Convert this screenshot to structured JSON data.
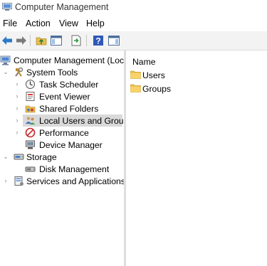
{
  "window": {
    "title": "Computer Management"
  },
  "menu": [
    "File",
    "Action",
    "View",
    "Help"
  ],
  "toolbar": {
    "buttons": [
      "back-icon",
      "forward-icon",
      "up-folder-icon",
      "show-hide-tree-icon",
      "export-list-icon",
      "help-icon",
      "show-hide-action-pane-icon"
    ]
  },
  "tree": {
    "root": {
      "label": "Computer Management (Local)",
      "icon": "computer-management-icon"
    },
    "system_tools": {
      "label": "System Tools",
      "icon": "tools-icon",
      "children": [
        {
          "label": "Task Scheduler",
          "icon": "clock-icon"
        },
        {
          "label": "Event Viewer",
          "icon": "event-viewer-icon"
        },
        {
          "label": "Shared Folders",
          "icon": "shared-folders-icon"
        },
        {
          "label": "Local Users and Groups",
          "icon": "users-icon",
          "selected": true
        },
        {
          "label": "Performance",
          "icon": "performance-icon"
        },
        {
          "label": "Device Manager",
          "icon": "device-manager-icon"
        }
      ]
    },
    "storage": {
      "label": "Storage",
      "icon": "storage-icon",
      "children": [
        {
          "label": "Disk Management",
          "icon": "disk-icon"
        }
      ]
    },
    "services": {
      "label": "Services and Applications",
      "icon": "services-icon"
    }
  },
  "list": {
    "column_header": "Name",
    "items": [
      {
        "label": "Users",
        "icon": "folder-icon"
      },
      {
        "label": "Groups",
        "icon": "folder-icon"
      }
    ]
  }
}
